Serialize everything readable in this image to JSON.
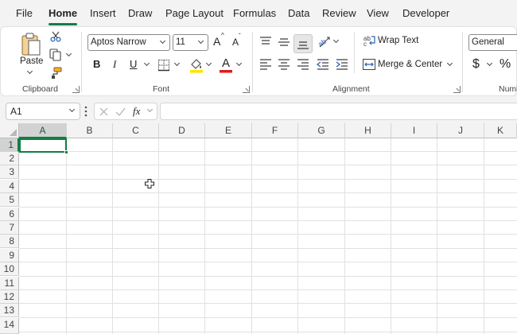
{
  "tabs": [
    "File",
    "Home",
    "Insert",
    "Draw",
    "Page Layout",
    "Formulas",
    "Data",
    "Review",
    "View",
    "Developer"
  ],
  "active_tab": "Home",
  "ribbon": {
    "clipboard": {
      "label": "Clipboard",
      "paste_label": "Paste"
    },
    "font": {
      "label": "Font",
      "font_name": "Aptos Narrow",
      "font_size": "11",
      "bold": "B",
      "italic": "I",
      "underline": "U",
      "grow": "A",
      "shrink": "A",
      "font_color_letter": "A",
      "fill_color": "#ffe400",
      "text_color": "#e0191e"
    },
    "alignment": {
      "label": "Alignment",
      "wrap_text": "Wrap Text",
      "merge_center": "Merge & Center"
    },
    "number": {
      "label": "Numb",
      "format": "General",
      "currency": "$",
      "percent": "%"
    }
  },
  "formula_bar": {
    "name_box": "A1",
    "fx_label": "fx",
    "value": ""
  },
  "grid": {
    "columns": [
      "A",
      "B",
      "C",
      "D",
      "E",
      "F",
      "G",
      "H",
      "I",
      "J",
      "K"
    ],
    "rows": [
      "1",
      "2",
      "3",
      "4",
      "5",
      "6",
      "7",
      "8",
      "9",
      "10",
      "11",
      "12",
      "13",
      "14"
    ],
    "selected_cell": "A1"
  },
  "colors": {
    "accent": "#117e45",
    "ribbon_bg": "#ffffff",
    "chrome_bg": "#f3f3f3"
  }
}
